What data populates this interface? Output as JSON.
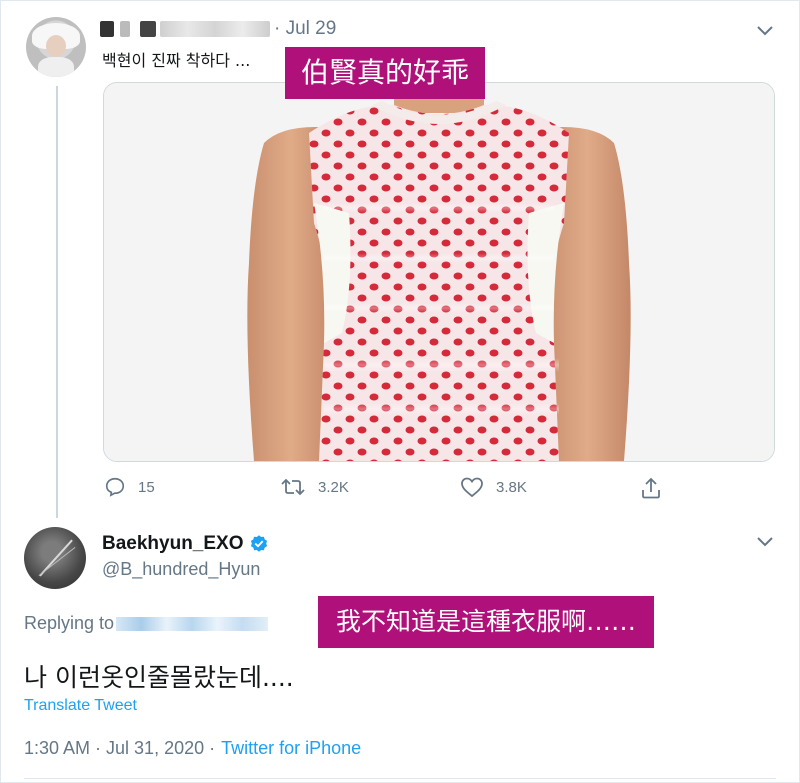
{
  "first_tweet": {
    "date": "· Jul 29",
    "text": "백현이 진짜 착하다 ...",
    "caption": "伯賢真的好乖",
    "actions": {
      "reply_count": "15",
      "retweet_count": "3.2K",
      "like_count": "3.8K"
    }
  },
  "reply_tweet": {
    "display_name": "Baekhyun_EXO",
    "handle": "@B_hundred_Hyun",
    "replying_label": "Replying to",
    "caption": "我不知道是這種衣服啊……",
    "text": "나 이런옷인줄몰랐눈데....",
    "translate_label": "Translate Tweet",
    "timestamp": "1:30 AM · Jul 31, 2020 · ",
    "source": "Twitter for iPhone"
  },
  "icons": {
    "menu": "chevron-down-icon",
    "reply": "comment-icon",
    "retweet": "retweet-icon",
    "like": "heart-icon",
    "share": "share-icon",
    "verified": "verified-badge-icon"
  },
  "colors": {
    "caption_bg": "#b0107a",
    "link": "#1da1f2",
    "muted": "#657786",
    "verified": "#1da1f2"
  }
}
